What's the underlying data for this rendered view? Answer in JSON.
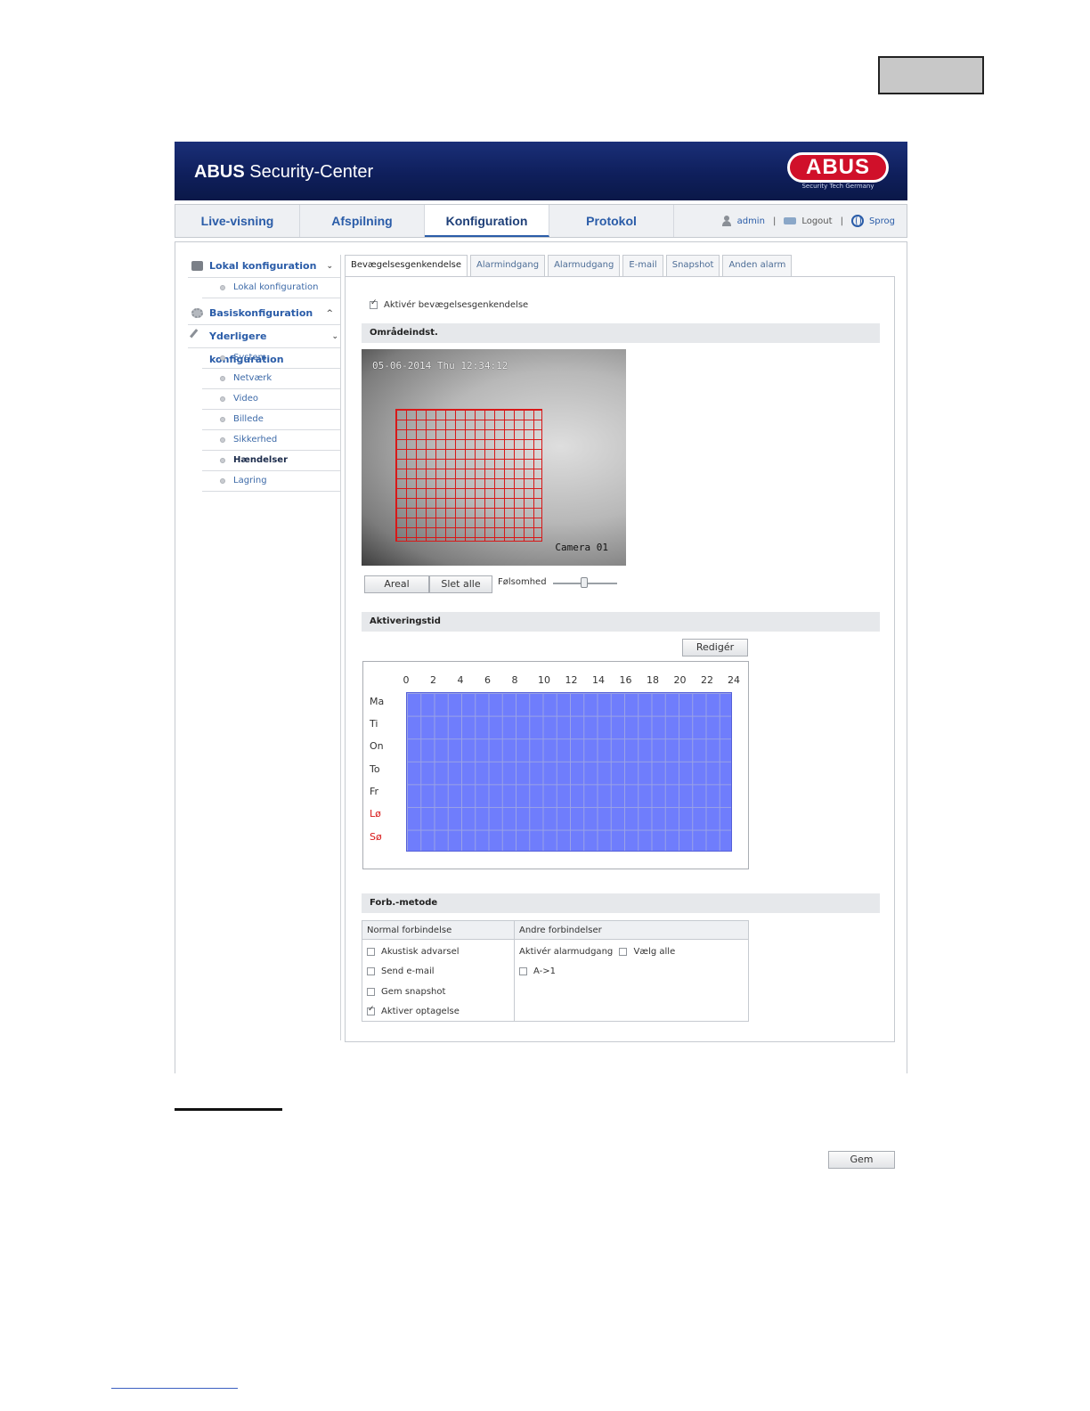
{
  "app": {
    "title_bold": "ABUS",
    "title_rest": " Security-Center",
    "logo_text": "ABUS",
    "logo_sub": "Security Tech Germany"
  },
  "nav": {
    "tabs": [
      "Live-visning",
      "Afspilning",
      "Konfiguration",
      "Protokol"
    ],
    "active_tab": "Konfiguration",
    "user": "admin",
    "logout": "Logout",
    "language": "Sprog",
    "separator": "|"
  },
  "sidebar": {
    "groups": [
      {
        "label": "Lokal konfiguration",
        "chevron": "⌄",
        "items": [
          "Lokal konfiguration"
        ]
      },
      {
        "label": "Basiskonfiguration",
        "chevron": "^",
        "items": []
      },
      {
        "label": "Yderligere konfiguration",
        "chevron": "⌄",
        "items": [
          "System",
          "Netværk",
          "Video",
          "Billede",
          "Sikkerhed",
          "Hændelser",
          "Lagring"
        ]
      }
    ],
    "active_item": "Hændelser"
  },
  "tabs": [
    "Bevægelsesgenkendelse",
    "Alarmindgang",
    "Alarmudgang",
    "E-mail",
    "Snapshot",
    "Anden alarm"
  ],
  "motion": {
    "enable_label": "Aktivér bevægelsesgenkendelse",
    "enable_checked": true,
    "area_section": "Områdeindst.",
    "video_timestamp": "05-06-2014 Thu 12:34:12",
    "video_camera": "Camera 01",
    "area_button": "Areal",
    "clear_button": "Slet alle",
    "sensitivity_label": "Følsomhed",
    "sensitivity_value": 0.5
  },
  "schedule": {
    "section": "Aktiveringstid",
    "edit_button": "Redigér",
    "hours": [
      "0",
      "2",
      "4",
      "6",
      "8",
      "10",
      "12",
      "14",
      "16",
      "18",
      "20",
      "22",
      "24"
    ],
    "days": [
      "Ma",
      "Ti",
      "On",
      "To",
      "Fr",
      "Lø",
      "Sø"
    ],
    "weekend_color": "#d81818",
    "fill_color": "#6f7dfc"
  },
  "linkage": {
    "section": "Forb.-metode",
    "normal_header": "Normal forbindelse",
    "other_header": "Andre forbindelser",
    "normal_items": [
      {
        "label": "Akustisk advarsel",
        "checked": false
      },
      {
        "label": "Send e-mail",
        "checked": false
      },
      {
        "label": "Gem snapshot",
        "checked": false
      },
      {
        "label": "Aktiver optagelse",
        "checked": true
      }
    ],
    "alarm_out_label": "Aktivér alarmudgang",
    "select_all_label": "Vælg alle",
    "alarm_out_items": [
      {
        "label": "A->1",
        "checked": false
      }
    ]
  },
  "save_button": "Gem"
}
